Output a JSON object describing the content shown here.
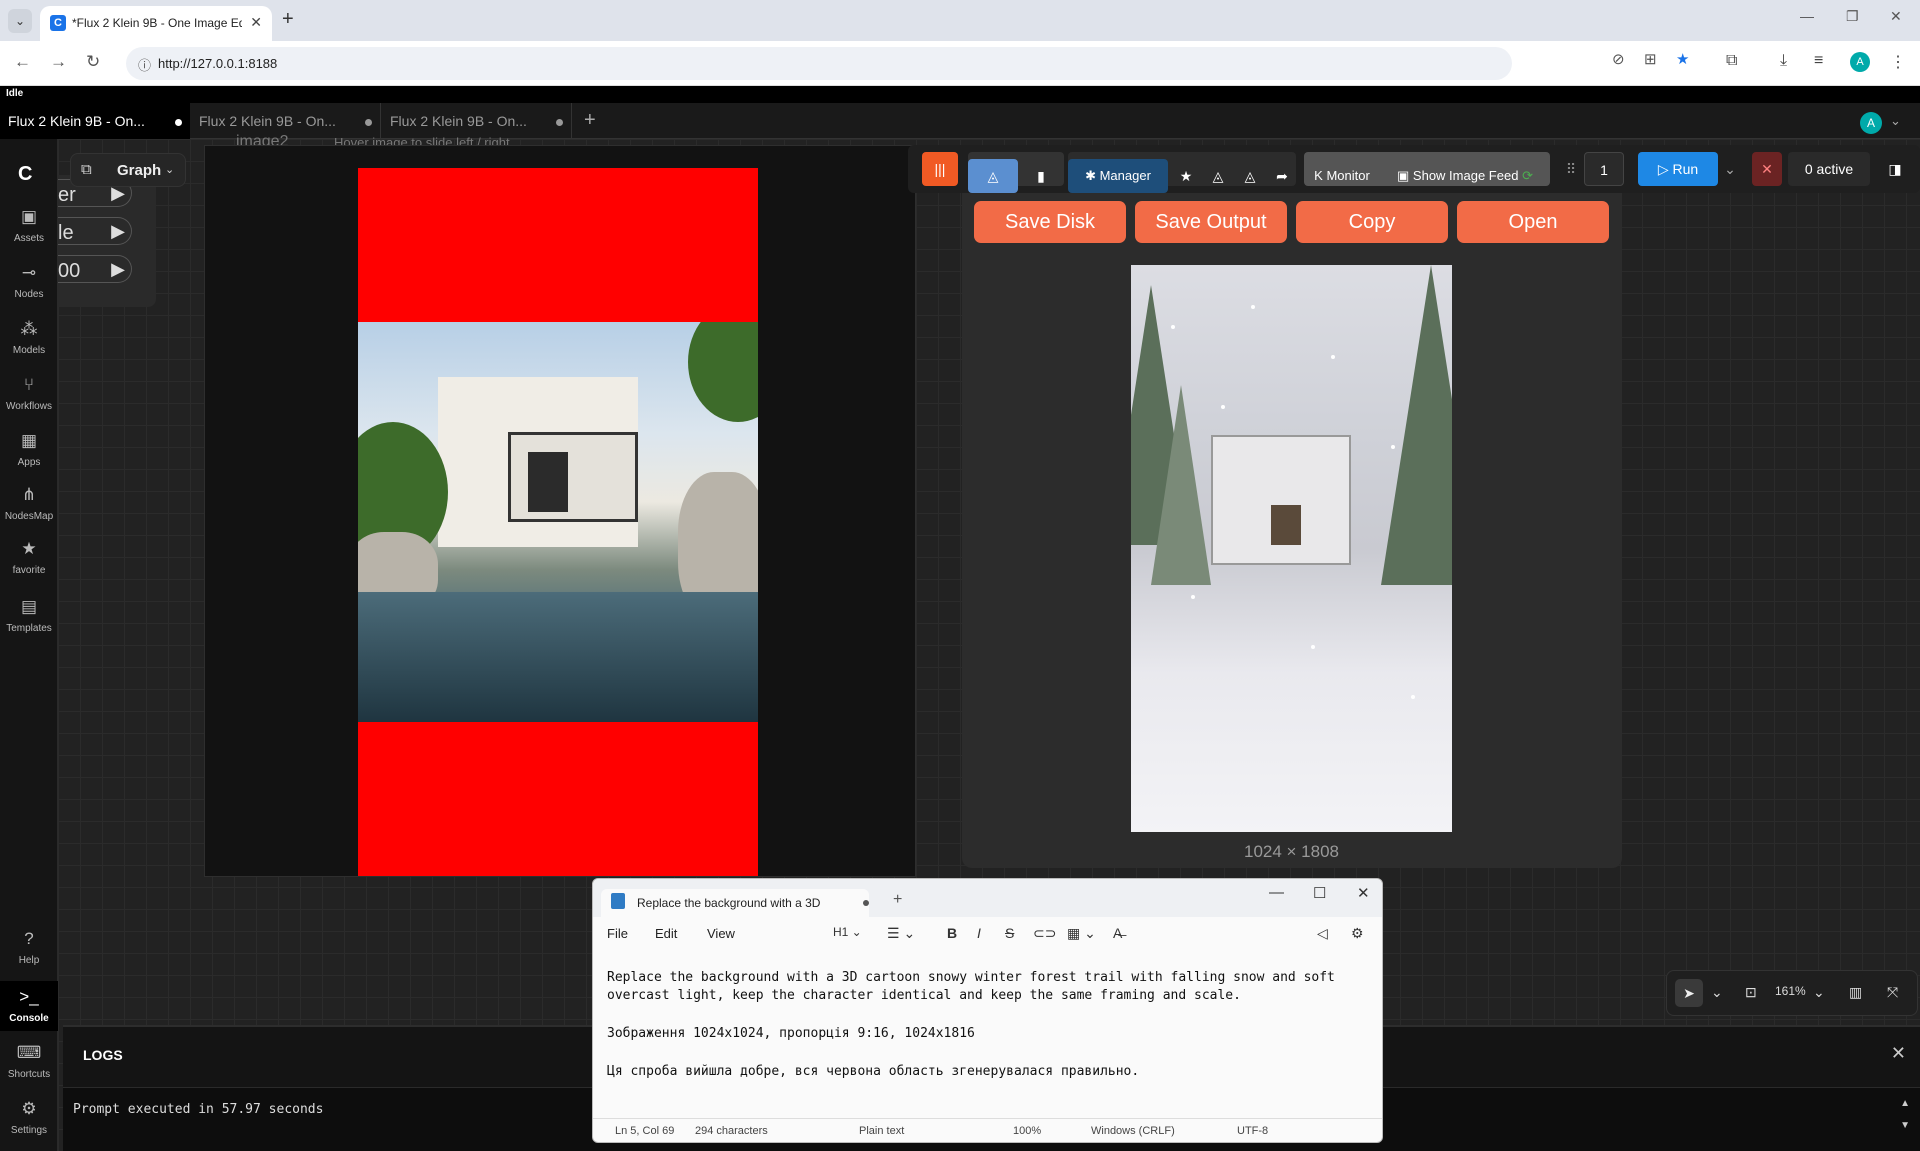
{
  "browser": {
    "tab_title": "*Flux 2 Klein 9B - One Image Ed",
    "url": "http://127.0.0.1:8188"
  },
  "app": {
    "status": "Idle",
    "workflow_tabs": [
      {
        "label": "Flux 2 Klein 9B - On...",
        "active": true
      },
      {
        "label": "Flux 2 Klein 9B - On...",
        "active": false
      },
      {
        "label": "Flux 2 Klein 9B - On...",
        "active": false
      }
    ],
    "user_initial": "A"
  },
  "sidebar": {
    "items": [
      {
        "label": "Assets",
        "icon": "image-icon"
      },
      {
        "label": "Nodes",
        "icon": "nodes-icon"
      },
      {
        "label": "Models",
        "icon": "models-icon"
      },
      {
        "label": "Workflows",
        "icon": "workflow-icon"
      },
      {
        "label": "Apps",
        "icon": "apps-icon"
      },
      {
        "label": "NodesMap",
        "icon": "nodesmap-icon"
      },
      {
        "label": "favorite",
        "icon": "star-icon"
      },
      {
        "label": "Templates",
        "icon": "templates-icon"
      }
    ],
    "bottom": [
      {
        "label": "Help",
        "icon": "help-icon"
      },
      {
        "label": "Console",
        "icon": "console-icon",
        "active": true
      },
      {
        "label": "Shortcuts",
        "icon": "keyboard-icon"
      },
      {
        "label": "Settings",
        "icon": "settings-icon"
      }
    ]
  },
  "canvas": {
    "graph_label": "Graph",
    "partial_node_rows": [
      "er",
      "le",
      "00"
    ],
    "image_node_name": "image2",
    "image_node_hint": "Hover image to slide left / right"
  },
  "toolbar": {
    "manager_label": "Manager",
    "monitor_label": "Monitor",
    "image_feed_label": "Show Image Feed",
    "batch_count": "1",
    "run_label": "Run",
    "active_label": "0 active"
  },
  "output_node": {
    "buttons": [
      "Save Disk",
      "Save Output",
      "Copy",
      "Open"
    ],
    "dimensions": "1024 × 1808"
  },
  "notepad": {
    "tab_title": "Replace the background with a 3D",
    "menus": [
      "File",
      "Edit",
      "View"
    ],
    "heading_select": "H1",
    "paragraphs": [
      "Replace the background with a 3D cartoon snowy winter forest trail with falling snow and soft overcast light, keep the character identical and keep the same framing and scale.",
      "Зображення 1024x1024, пропорція 9:16, 1024x1816",
      "Ця спроба вийшла добре, вся червона область згенерувалася правильно."
    ],
    "status": {
      "position": "Ln 5, Col 69",
      "chars": "294 characters",
      "format": "Plain text",
      "zoom": "100%",
      "line_ending": "Windows (CRLF)",
      "encoding": "UTF-8"
    }
  },
  "logs": {
    "title": "LOGS",
    "line": "Prompt executed in 57.97 seconds"
  },
  "zoom": {
    "level": "161%"
  },
  "colors": {
    "accent_orange": "#f26b47",
    "run_blue": "#1e88e5",
    "frame_red": "#ff0000"
  }
}
